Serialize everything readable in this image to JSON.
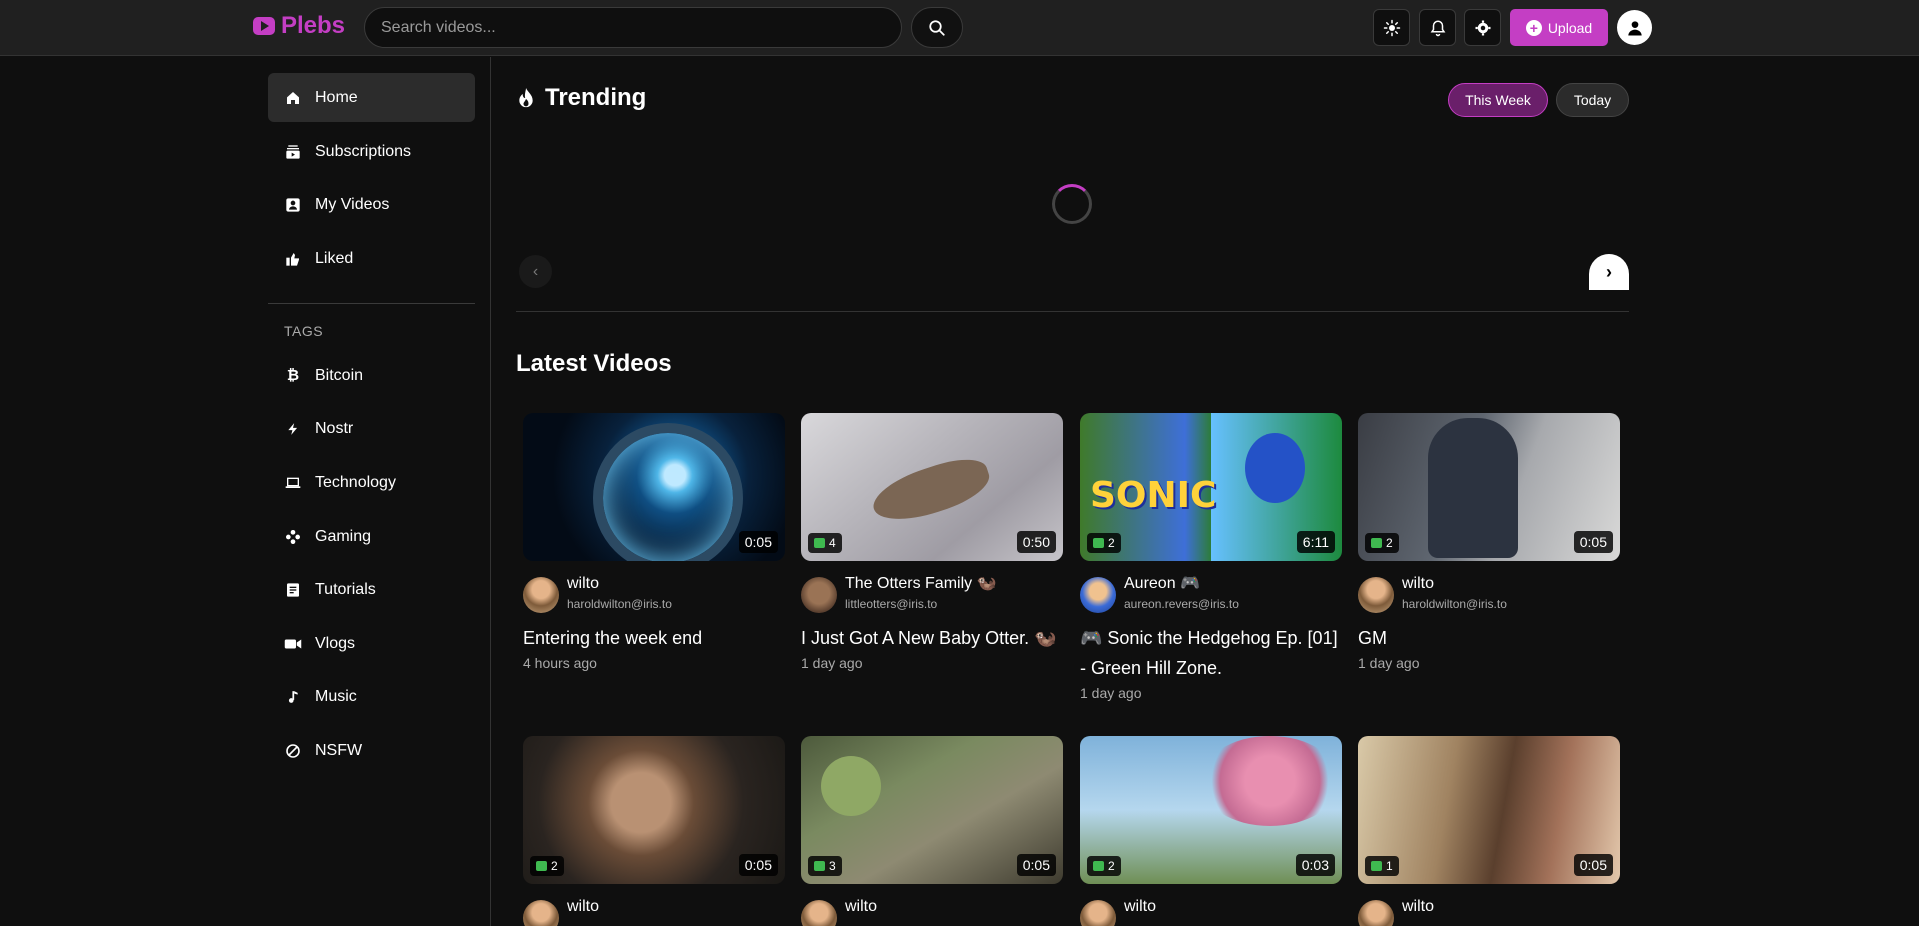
{
  "app": {
    "name": "Plebs"
  },
  "header": {
    "search_placeholder": "Search videos...",
    "upload_label": "Upload"
  },
  "sidebar": {
    "items": [
      {
        "label": "Home",
        "icon": "home-icon",
        "active": true
      },
      {
        "label": "Subscriptions",
        "icon": "subscriptions-icon"
      },
      {
        "label": "My Videos",
        "icon": "my-videos-icon"
      },
      {
        "label": "Liked",
        "icon": "thumbs-up-icon"
      }
    ],
    "tags_title": "TAGS",
    "tags": [
      {
        "label": "Bitcoin",
        "icon": "bitcoin-icon"
      },
      {
        "label": "Nostr",
        "icon": "lightning-icon"
      },
      {
        "label": "Technology",
        "icon": "laptop-icon"
      },
      {
        "label": "Gaming",
        "icon": "gamepad-icon"
      },
      {
        "label": "Tutorials",
        "icon": "document-icon"
      },
      {
        "label": "Vlogs",
        "icon": "video-camera-icon"
      },
      {
        "label": "Music",
        "icon": "music-note-icon"
      },
      {
        "label": "NSFW",
        "icon": "prohibited-icon"
      }
    ]
  },
  "trending": {
    "title": "Trending",
    "filters": [
      "This Week",
      "Today"
    ],
    "active_filter": "This Week"
  },
  "latest": {
    "title": "Latest Videos",
    "videos": [
      {
        "duration": "0:05",
        "likes": "",
        "channel": "wilto",
        "handle": "haroldwilton@iris.to",
        "title": "Entering the week end",
        "time": "4 hours ago"
      },
      {
        "duration": "0:50",
        "likes": "4",
        "channel": "The Otters Family 🦦",
        "handle": "littleotters@iris.to",
        "title": "I Just Got A New Baby Otter. 🦦",
        "time": "1 day ago"
      },
      {
        "duration": "6:11",
        "likes": "2",
        "channel": "Aureon 🎮",
        "handle": "aureon.revers@iris.to",
        "title": "🎮 Sonic the Hedgehog Ep. [01] - Green Hill Zone.",
        "time": "1 day ago"
      },
      {
        "duration": "0:05",
        "likes": "2",
        "channel": "wilto",
        "handle": "haroldwilton@iris.to",
        "title": "GM",
        "time": "1 day ago"
      },
      {
        "duration": "0:05",
        "likes": "2",
        "channel": "wilto",
        "handle": "",
        "title": "",
        "time": ""
      },
      {
        "duration": "0:05",
        "likes": "3",
        "channel": "wilto",
        "handle": "",
        "title": "",
        "time": ""
      },
      {
        "duration": "0:03",
        "likes": "2",
        "channel": "wilto",
        "handle": "",
        "title": "",
        "time": ""
      },
      {
        "duration": "0:05",
        "likes": "1",
        "channel": "wilto",
        "handle": "",
        "title": "",
        "time": ""
      }
    ]
  },
  "colors": {
    "accent": "#c43ec4",
    "background": "#0f0f0f",
    "topbar": "#202020",
    "like": "#3fb950"
  }
}
